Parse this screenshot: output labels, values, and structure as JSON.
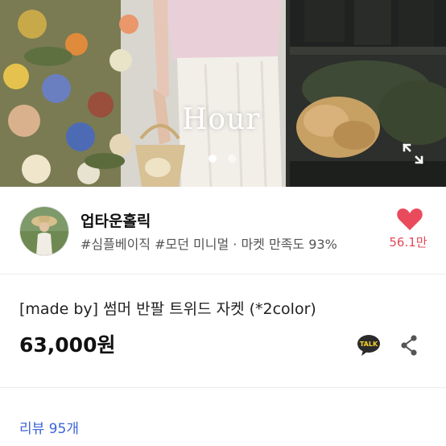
{
  "hero": {
    "overlay_text": "Hour",
    "slide_count": 2,
    "active_slide": 1
  },
  "shop": {
    "name": "업타운홀릭",
    "tags": "#심플베이직 #모던 미니멀 · 마켓 만족도 93%",
    "likes": "56.1만"
  },
  "product": {
    "title": "[made by] 썸머 반팔 트위드 자켓 (*2color)",
    "price": "63,000원"
  },
  "actions": {
    "talk_label": "TALK"
  },
  "reviews": {
    "link_text": "리뷰 95개"
  },
  "colors": {
    "like": "#e3485a",
    "link": "#3b63d6",
    "heart": "#e94b5d"
  },
  "icons": [
    "expand-icon",
    "heart-icon",
    "kakaotalk-icon",
    "share-icon"
  ]
}
